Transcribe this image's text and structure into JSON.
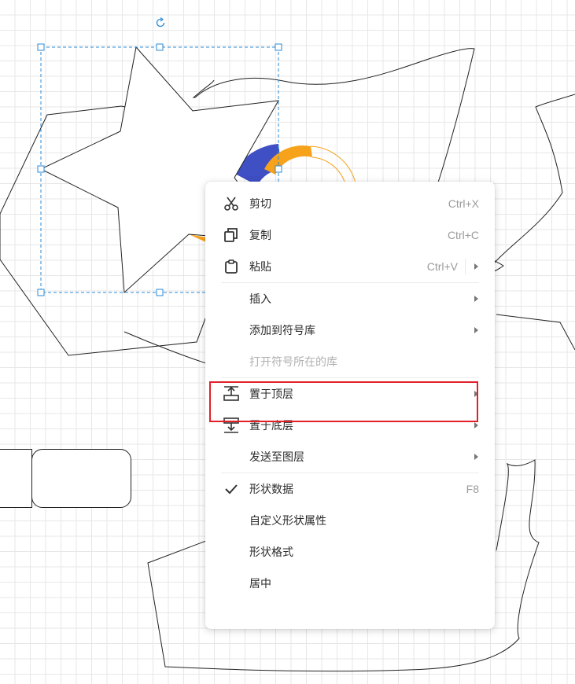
{
  "colors": {
    "grid": "#e7e7e7",
    "selection": "#2a8ad6",
    "blue_shape": "#3f4fc4",
    "orange_shape": "#f7a21b",
    "highlight": "#e3202a",
    "disabled_text": "#b0b0b0",
    "shortcut_text": "#9b9b9b"
  },
  "menu": {
    "cut": {
      "label": "剪切",
      "shortcut": "Ctrl+X",
      "icon": "scissors-icon"
    },
    "copy": {
      "label": "复制",
      "shortcut": "Ctrl+C",
      "icon": "copy-icon"
    },
    "paste": {
      "label": "粘贴",
      "shortcut": "Ctrl+V",
      "icon": "clipboard-icon"
    },
    "insert": {
      "label": "插入"
    },
    "add_to_library": {
      "label": "添加到符号库"
    },
    "open_library": {
      "label": "打开符号所在的库",
      "disabled": true
    },
    "bring_to_front": {
      "label": "置于顶层",
      "icon": "bring-to-front-icon"
    },
    "send_to_back": {
      "label": "置于底层",
      "icon": "send-to-back-icon"
    },
    "send_to_layer": {
      "label": "发送至图层"
    },
    "shape_data": {
      "label": "形状数据",
      "shortcut": "F8",
      "checked": true,
      "icon": "checkmark-icon"
    },
    "custom_properties": {
      "label": "自定义形状属性"
    },
    "shape_format": {
      "label": "形状格式"
    },
    "center": {
      "label": "居中"
    }
  }
}
